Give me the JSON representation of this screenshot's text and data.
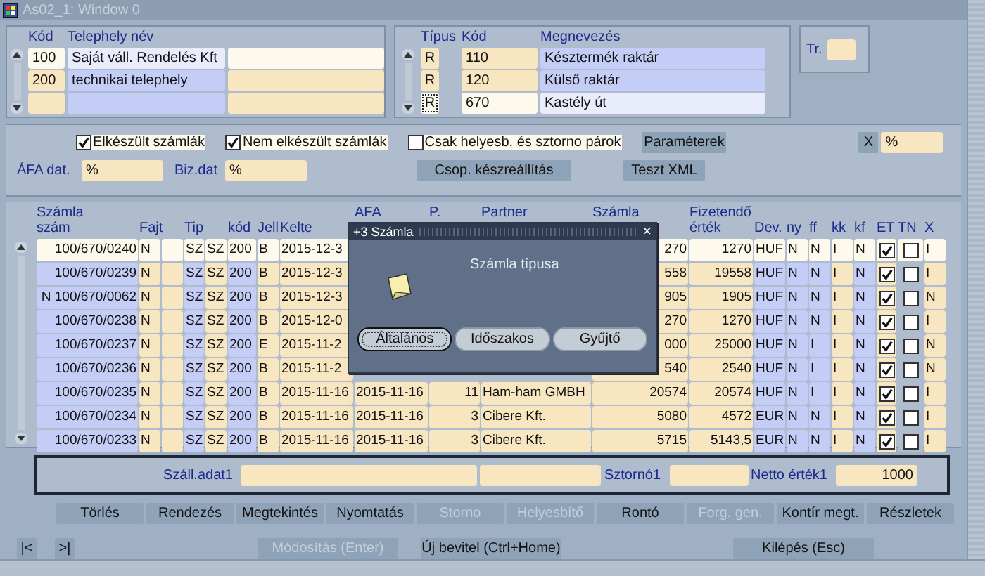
{
  "window": {
    "title": "As02_1: Window 0"
  },
  "sites": {
    "columns": [
      "Kód",
      "Telephely név"
    ],
    "rows": [
      {
        "code": "100",
        "name": "Saját váll. Rendelés Kft",
        "selected": true
      },
      {
        "code": "200",
        "name": "technikai telephely",
        "selected": false
      },
      {
        "selected": false
      }
    ]
  },
  "warehouses": {
    "columns": [
      "Típus",
      "Kód",
      "Megnevezés"
    ],
    "rows": [
      {
        "type": "R",
        "code": "110",
        "name": "Késztermék raktár",
        "selected": false
      },
      {
        "type": "R",
        "code": "120",
        "name": "Külső raktár",
        "selected": false
      },
      {
        "type": "R",
        "code": "670",
        "name": "Kastély út",
        "selected": true
      }
    ]
  },
  "tr": {
    "label": "Tr."
  },
  "filters": {
    "checkboxes": [
      {
        "label": "Elkészült számlák",
        "checked": true
      },
      {
        "label": "Nem elkészült számlák",
        "checked": true
      },
      {
        "label": "Csak helyesb. és sztorno párok",
        "checked": false
      }
    ],
    "parameters_button": "Paraméterek",
    "x_button": "X",
    "x_value": "%",
    "afa_label": "ÁFA dat.",
    "afa_value": "%",
    "biz_label": "Biz.dat",
    "biz_value": "%",
    "group_button": "Csop. készreállítás",
    "xml_button": "Teszt XML"
  },
  "invoices": {
    "columns": [
      {
        "top": "Számla",
        "label": "szám",
        "kind": "number"
      },
      {
        "label": "Fajt",
        "kind": "text"
      },
      {
        "kind": "text"
      },
      {
        "label": "Tip",
        "kind": "text"
      },
      {
        "kind": "text"
      },
      {
        "label": "kód",
        "kind": "text"
      },
      {
        "label": "Jell",
        "kind": "text"
      },
      {
        "label": "Kelte",
        "kind": "text"
      },
      {
        "top": "AFA",
        "kind": "text"
      },
      {
        "top": "P.",
        "kind": "number"
      },
      {
        "top": "Partner",
        "kind": "text"
      },
      {
        "top": "Számla",
        "kind": "number"
      },
      {
        "top": "Fizetendő",
        "label": "érték",
        "kind": "number"
      },
      {
        "label": "Dev.",
        "kind": "text"
      },
      {
        "label": "ny",
        "kind": "text"
      },
      {
        "label": "ff",
        "kind": "text"
      },
      {
        "label": "kk",
        "kind": "text"
      },
      {
        "label": "kf",
        "kind": "text"
      },
      {
        "label": "ET",
        "kind": "check"
      },
      {
        "label": "TN",
        "kind": "check"
      },
      {
        "label": "X",
        "kind": "text"
      }
    ],
    "rows": [
      {
        "selected": true,
        "cells": [
          "100/670/0240",
          "N",
          null,
          "SZ",
          "SZ",
          "200",
          "B",
          "2015-12-3",
          null,
          null,
          null,
          "270",
          "1270",
          "HUF",
          "N",
          "N",
          "I",
          "N",
          true,
          false,
          "I"
        ]
      },
      {
        "selected": false,
        "cells": [
          "100/670/0239",
          "N",
          null,
          "SZ",
          "SZ",
          "200",
          "B",
          "2015-12-3",
          null,
          null,
          null,
          "558",
          "19558",
          "HUF",
          "N",
          "N",
          "I",
          "N",
          true,
          false,
          "I"
        ]
      },
      {
        "selected": false,
        "cells": [
          "N 100/670/0062",
          "N",
          null,
          "SZ",
          "SZ",
          "200",
          "B",
          "2015-12-3",
          null,
          null,
          null,
          "905",
          "1905",
          "HUF",
          "N",
          "N",
          "I",
          "N",
          true,
          false,
          "N"
        ]
      },
      {
        "selected": false,
        "cells": [
          "100/670/0238",
          "N",
          null,
          "SZ",
          "SZ",
          "200",
          "B",
          "2015-12-0",
          null,
          null,
          null,
          "270",
          "1270",
          "HUF",
          "N",
          "N",
          "I",
          "N",
          true,
          false,
          "I"
        ]
      },
      {
        "selected": false,
        "cells": [
          "100/670/0237",
          "N",
          null,
          "SZ",
          "SZ",
          "200",
          "E",
          "2015-11-2",
          null,
          null,
          null,
          "000",
          "25000",
          "HUF",
          "N",
          "I",
          "I",
          "N",
          true,
          false,
          "N"
        ]
      },
      {
        "selected": false,
        "cells": [
          "100/670/0236",
          "N",
          null,
          "SZ",
          "SZ",
          "200",
          "B",
          "2015-11-2",
          null,
          null,
          null,
          "540",
          "2540",
          "HUF",
          "N",
          "I",
          "I",
          "N",
          true,
          false,
          "N"
        ]
      },
      {
        "selected": false,
        "cells": [
          "100/670/0235",
          "N",
          null,
          "SZ",
          "SZ",
          "200",
          "B",
          "2015-11-16",
          "2015-11-16",
          "11",
          "Ham-ham GMBH",
          "20574",
          "20574",
          "HUF",
          "N",
          "I",
          "I",
          "N",
          true,
          false,
          "I"
        ]
      },
      {
        "selected": false,
        "cells": [
          "100/670/0234",
          "N",
          null,
          "SZ",
          "SZ",
          "200",
          "B",
          "2015-11-16",
          "2015-11-16",
          "3",
          "Cibere Kft.",
          "5080",
          "4572",
          "EUR",
          "N",
          "N",
          "I",
          "N",
          true,
          false,
          "I"
        ]
      },
      {
        "selected": false,
        "cells": [
          "100/670/0233",
          "N",
          null,
          "SZ",
          "SZ",
          "200",
          "B",
          "2015-11-16",
          "2015-11-16",
          "3",
          "Cibere Kft.",
          "5715",
          "5143,5",
          "EUR",
          "N",
          "N",
          "I",
          "N",
          true,
          false,
          "I"
        ]
      }
    ]
  },
  "dialog": {
    "title": "+3 Számla",
    "close": "×",
    "message": "Számla típusa",
    "buttons": [
      {
        "label": "Általános",
        "selected": true
      },
      {
        "label": "Időszakos",
        "selected": false
      },
      {
        "label": "Gyűjtő",
        "selected": false
      }
    ]
  },
  "shipping": {
    "label": "Száll.adat1",
    "storno_label": "Sztornó1",
    "net_label": "Netto érték1",
    "net_value": "1000"
  },
  "actions": [
    {
      "label": "Törlés",
      "disabled": false
    },
    {
      "label": "Rendezés",
      "disabled": false
    },
    {
      "label": "Megtekintés",
      "disabled": false
    },
    {
      "label": "Nyomtatás",
      "disabled": false
    },
    {
      "label": "Storno",
      "disabled": true
    },
    {
      "label": "Helyesbítő",
      "disabled": true
    },
    {
      "label": "Rontó",
      "disabled": false
    },
    {
      "label": "Forg. gen.",
      "disabled": true
    },
    {
      "label": "Kontír megt.",
      "disabled": false
    },
    {
      "label": "Részletek",
      "disabled": false
    }
  ],
  "nav": [
    "|<",
    ">|"
  ],
  "footer_buttons": [
    {
      "label": "Módosítás (Enter)",
      "disabled": true
    },
    {
      "label": "Új bevitel (Ctrl+Home)",
      "disabled": false
    },
    {
      "label": "Kilépés (Esc)",
      "disabled": false
    }
  ]
}
